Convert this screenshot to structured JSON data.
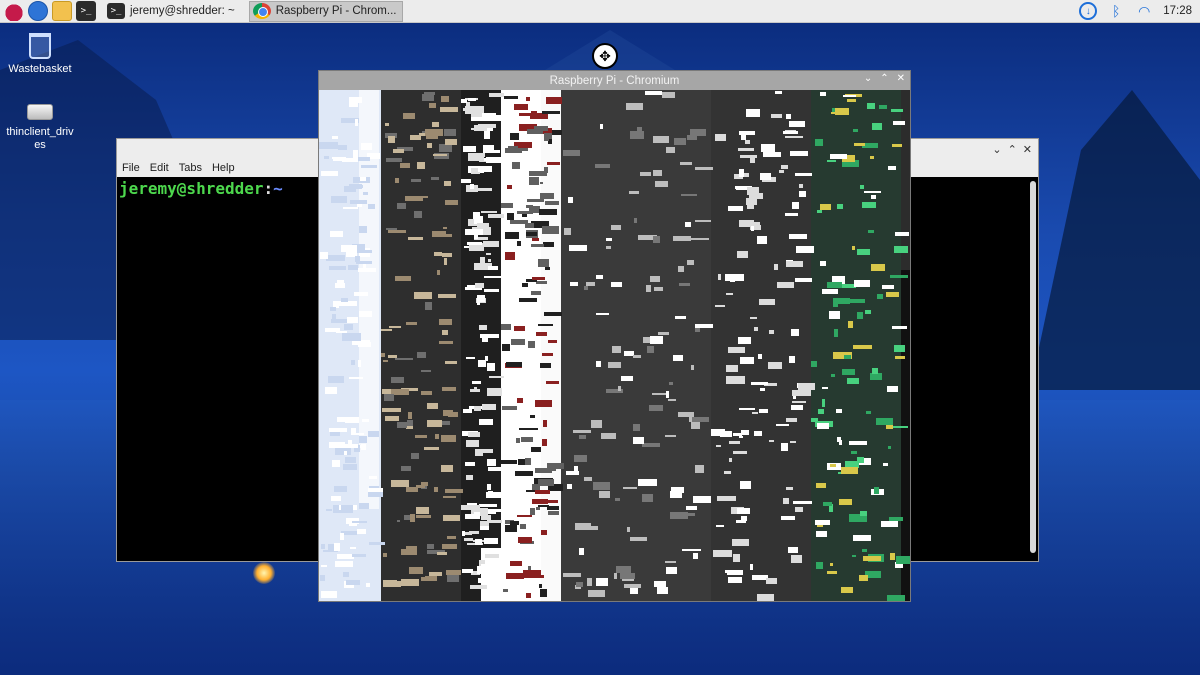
{
  "taskbar": {
    "launchers": [
      {
        "icon": "raspberry-pi-menu-icon"
      },
      {
        "icon": "web-browser-icon"
      },
      {
        "icon": "file-manager-icon"
      },
      {
        "icon": "terminal-launcher-icon"
      }
    ],
    "tasks": [
      {
        "label": "jeremy@shredder: ~",
        "icon": "terminal-icon",
        "active": false
      },
      {
        "label": "Raspberry Pi - Chrom...",
        "icon": "chromium-icon",
        "active": true
      }
    ],
    "tray": {
      "icons": [
        "download-icon",
        "bluetooth-icon",
        "wifi-icon"
      ],
      "clock": "17:28"
    }
  },
  "desktop": {
    "icons": [
      {
        "label": "Wastebasket",
        "icon": "wastebasket-icon"
      },
      {
        "label": "thinclient_drives",
        "icon": "drive-icon"
      }
    ]
  },
  "terminal": {
    "menu": [
      "File",
      "Edit",
      "Tabs",
      "Help"
    ],
    "prompt_user": "jeremy@shredder",
    "prompt_sep": ":",
    "prompt_path": "~"
  },
  "chromium": {
    "title": "Raspberry Pi - Chromium"
  },
  "colors": {
    "terminal_prompt_user": "#4dd84d",
    "terminal_prompt_path": "#6b8cff",
    "chromium_titlebar": "#a6a6a6",
    "taskbar_bg": "#ececec"
  }
}
